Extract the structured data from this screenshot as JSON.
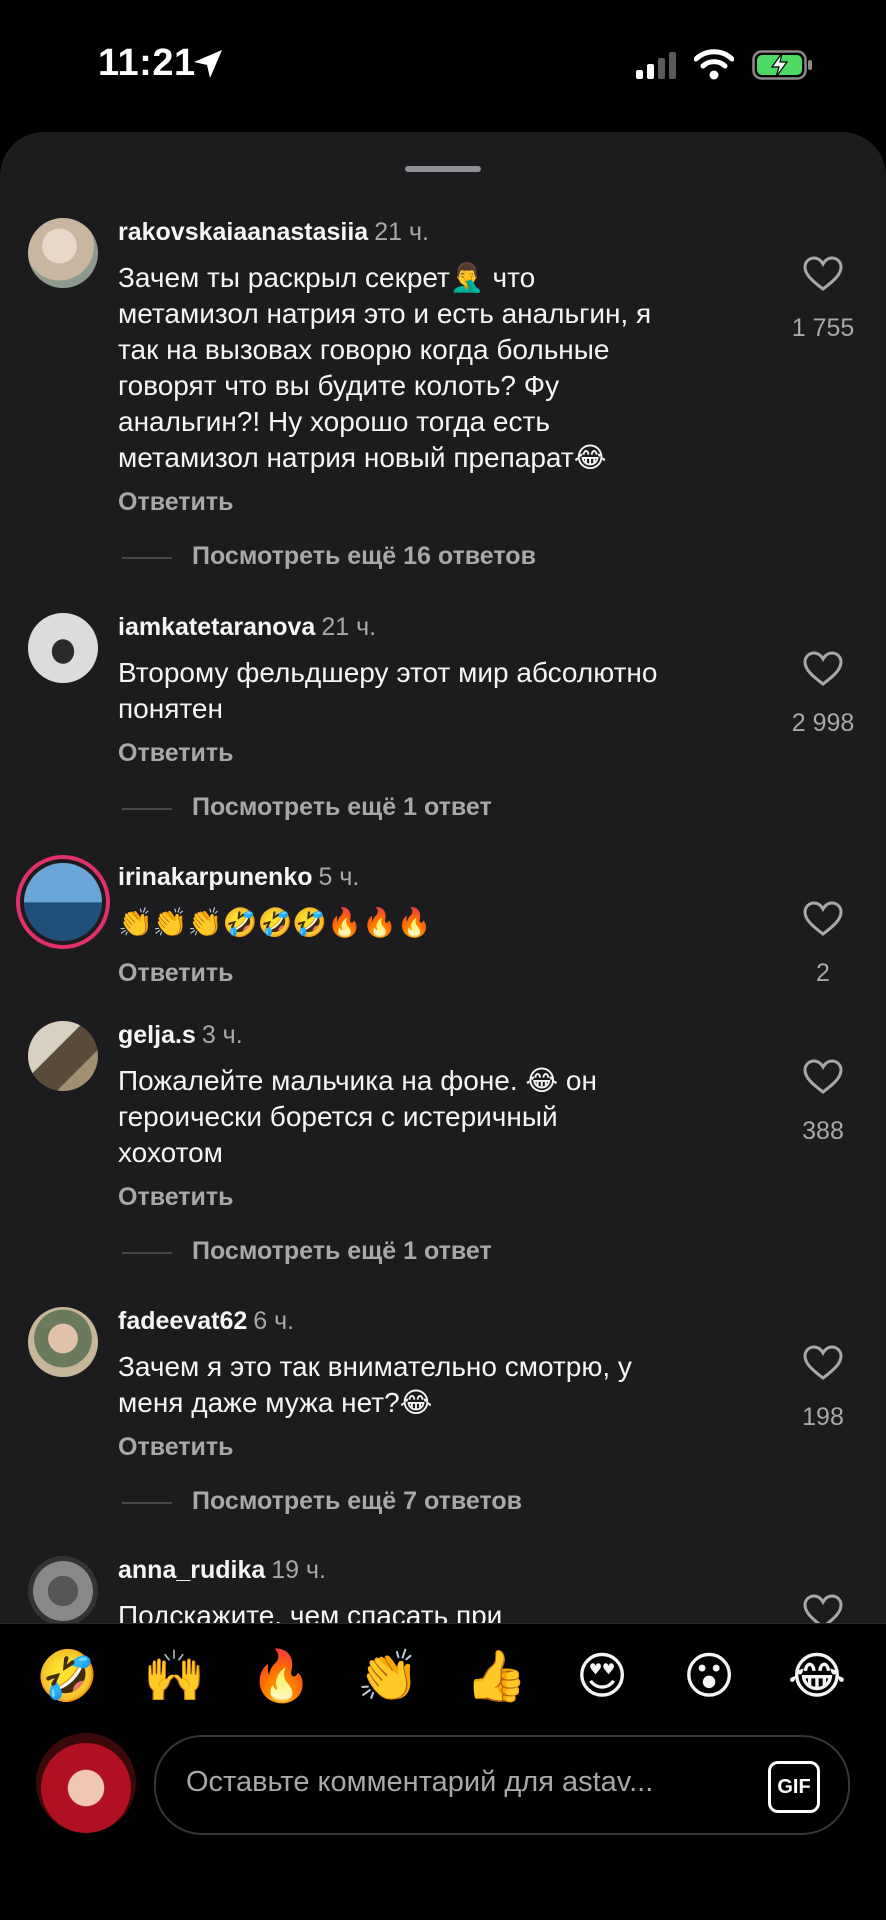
{
  "status": {
    "time": "11:21"
  },
  "comments": [
    {
      "user": "rakovskaiaanastasiia",
      "time": "21 ч.",
      "lines": [
        "Зачем ты раскрыл секрет🤦‍♂️ что",
        "метамизол натрия это и есть анальгин, я",
        "так на вызовах говорю когда больные",
        "говорят что вы будите колоть? Фу",
        "анальгин?! Ну хорошо тогда есть",
        "метамизол натрия новый препарат😂"
      ],
      "likes": "1 755",
      "reply": "Ответить",
      "more": "Посмотреть ещё 16 ответов"
    },
    {
      "user": "iamkatetaranova",
      "time": "21 ч.",
      "lines": [
        "Второму фельдшеру этот мир абсолютно",
        "понятен"
      ],
      "likes": "2 998",
      "reply": "Ответить",
      "more": "Посмотреть ещё 1 ответ"
    },
    {
      "user": "irinakarpunenko",
      "time": "5 ч.",
      "lines": [
        "👏👏👏🤣🤣🤣🔥🔥🔥"
      ],
      "likes": "2",
      "reply": "Ответить"
    },
    {
      "user": "gelja.s",
      "time": "3 ч.",
      "lines": [
        "Пожалейте мальчика на фоне. 😂 он",
        "героически борется с истеричный",
        "хохотом"
      ],
      "likes": "388",
      "reply": "Ответить",
      "more": "Посмотреть ещё 1 ответ"
    },
    {
      "user": "fadeevat62",
      "time": "6 ч.",
      "lines": [
        "Зачем я это так внимательно смотрю, у",
        "меня даже мужа нет?😂"
      ],
      "likes": "198",
      "reply": "Ответить",
      "more": "Посмотреть ещё 7 ответов"
    },
    {
      "user": "anna_rudika",
      "time": "19 ч.",
      "lines": [
        "Подскажите, чем спасать при"
      ]
    }
  ],
  "quick_emojis": [
    "🤣",
    "🙌",
    "🔥",
    "👏",
    "👍",
    "😍",
    "😮",
    "😂"
  ],
  "composer": {
    "placeholder": "Оставьте комментарий для astav...",
    "gif_label": "GIF"
  },
  "colors": {
    "sheet_bg": "#1c1c1e",
    "text": "#f5f5f5",
    "secondary": "#a8a8a8",
    "battery_green": "#4cd964"
  }
}
